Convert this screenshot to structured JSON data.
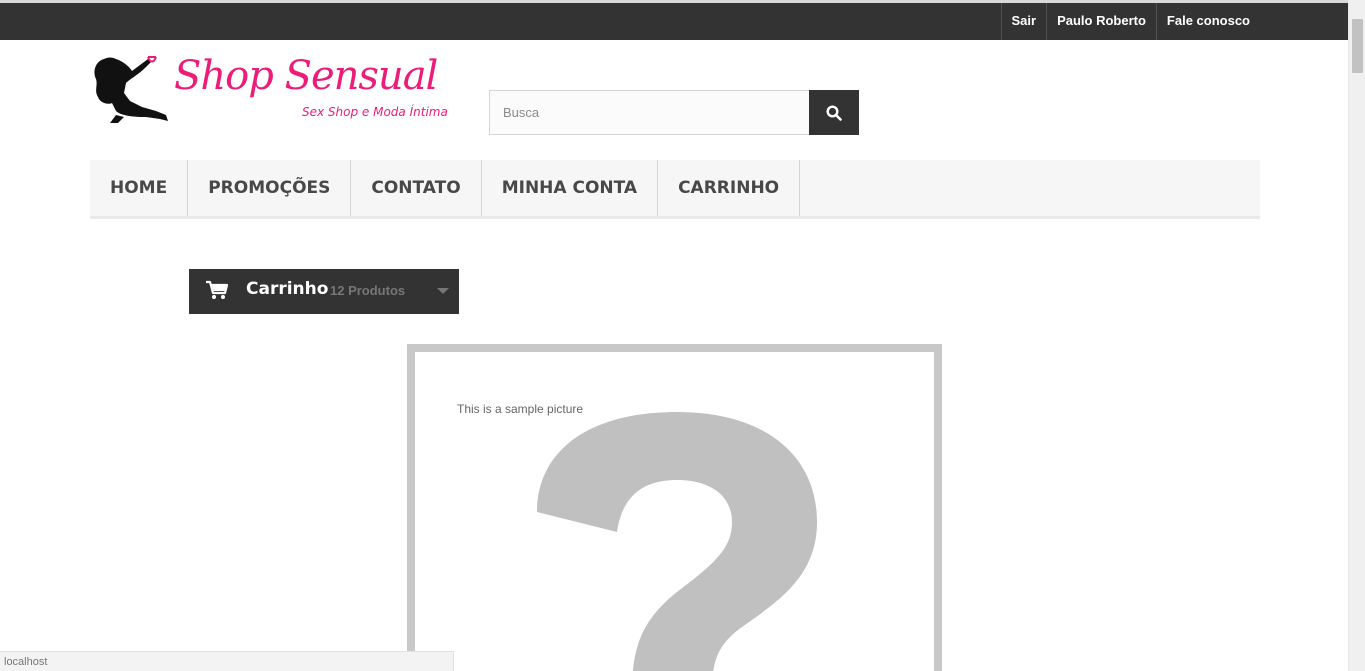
{
  "topbar": {
    "links": [
      "Sair",
      "Paulo Roberto",
      "Fale conosco"
    ]
  },
  "logo": {
    "brand": "Shop Sensual",
    "tagline": "Sex Shop e Moda Íntima"
  },
  "search": {
    "placeholder": "Busca",
    "button_icon": "search-icon"
  },
  "nav": {
    "items": [
      "HOME",
      "PROMOÇÕES",
      "CONTATO",
      "MINHA CONTA",
      "CARRINHO"
    ]
  },
  "cart": {
    "icon": "shopping-cart-icon",
    "title": "Carrinho",
    "quantity": "12 Produtos"
  },
  "sample_image": {
    "caption": "This is a sample picture"
  },
  "status_bar": {
    "url": "localhost"
  },
  "colors": {
    "brand_pink": "#ec1c79",
    "dark": "#333333",
    "nav_bg": "#f6f6f6"
  }
}
